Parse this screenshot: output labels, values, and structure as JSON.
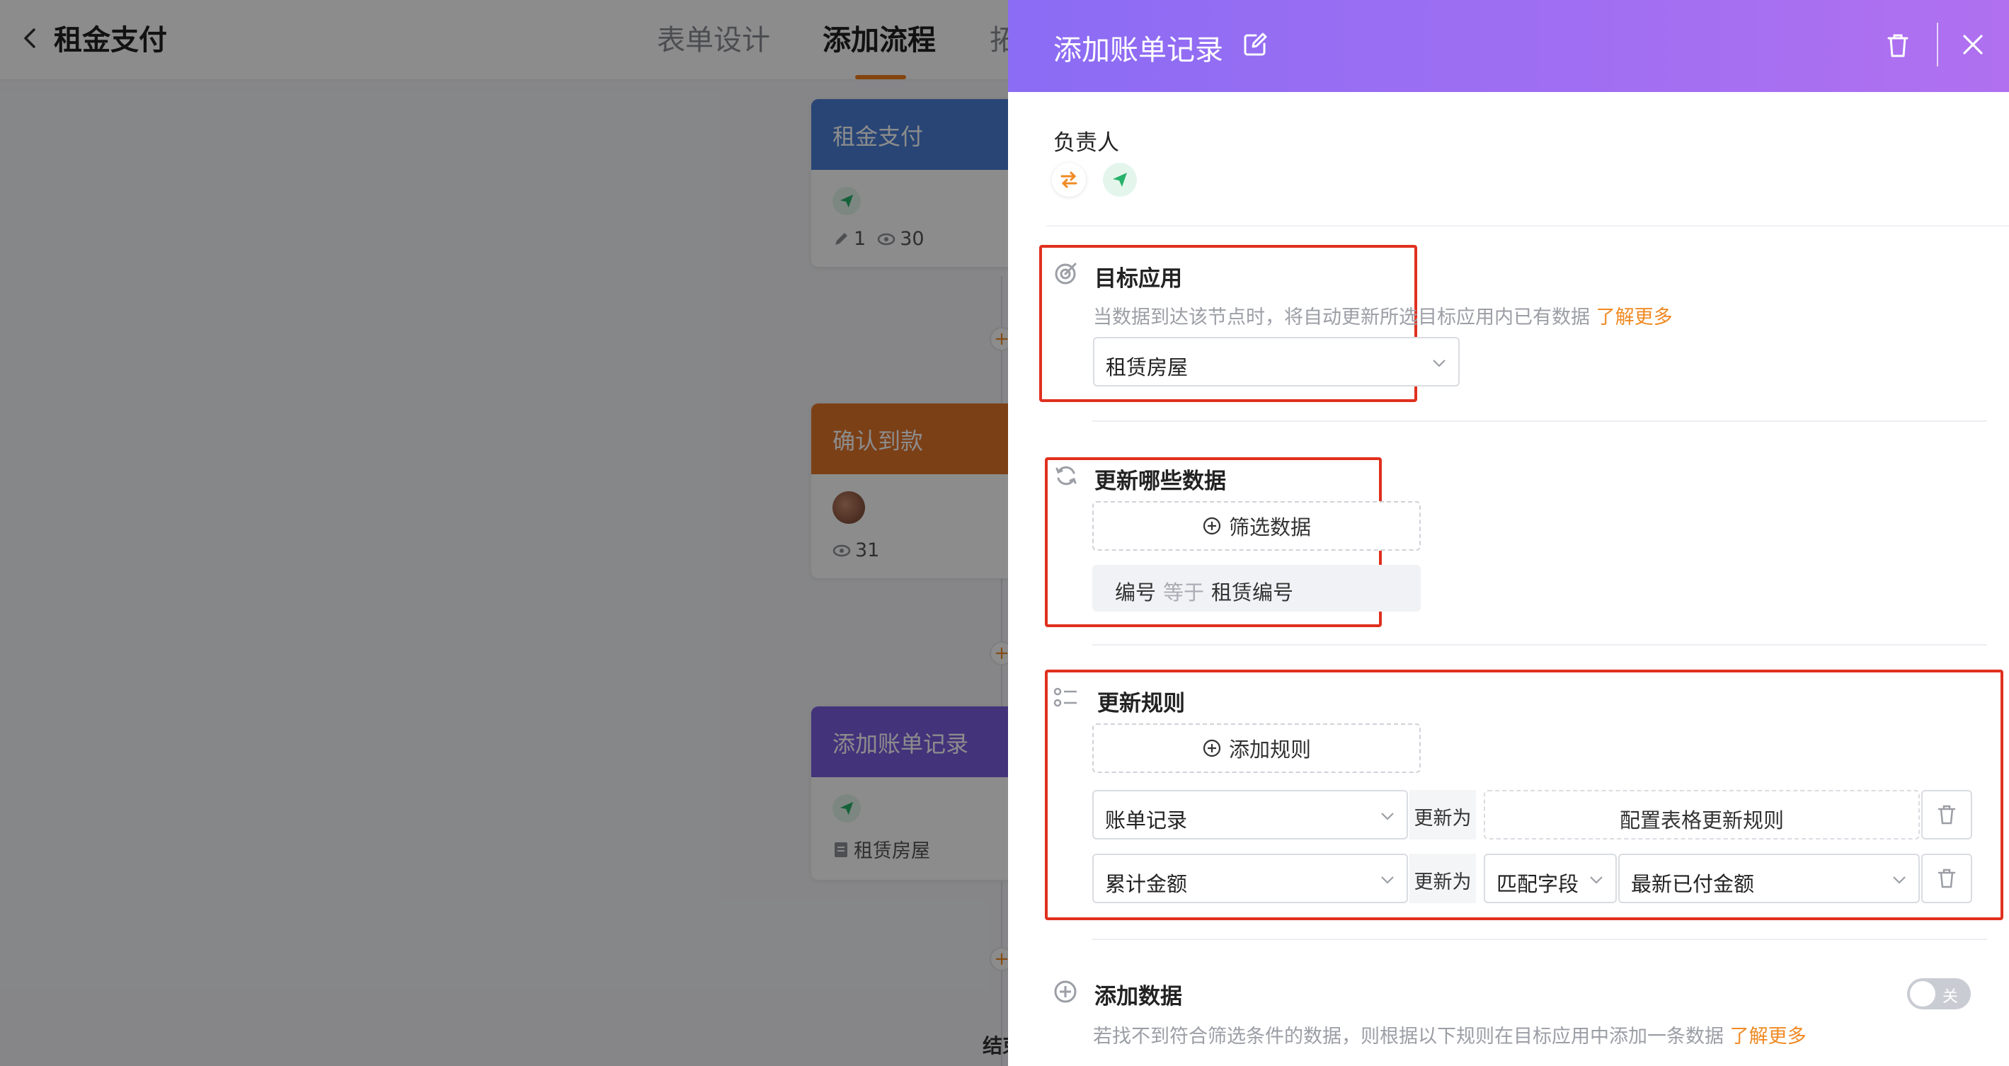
{
  "header": {
    "title": "租金支付",
    "tabs": [
      "表单设计",
      "添加流程",
      "拓"
    ]
  },
  "flow": {
    "nodes": [
      {
        "title": "租金支付",
        "color": "#4a7fd6",
        "stats": {
          "edits": "1",
          "views": "30"
        }
      },
      {
        "title": "确认到款",
        "color": "#e2752a",
        "stats": {
          "views": "31"
        }
      },
      {
        "title": "添加账单记录",
        "color": "#7b5ee0",
        "form": "租赁房屋"
      }
    ],
    "end_label": "结束"
  },
  "drawer": {
    "title": "添加账单记录",
    "owner": {
      "label": "负责人"
    },
    "target_app": {
      "title": "目标应用",
      "desc": "当数据到达该节点时，将自动更新所选目标应用内已有数据",
      "learn_more": "了解更多",
      "selected": "租赁房屋"
    },
    "which_data": {
      "title": "更新哪些数据",
      "filter_btn": "筛选数据",
      "condition": {
        "field": "编号",
        "op": "等于",
        "value": "租赁编号"
      }
    },
    "rules": {
      "title": "更新规则",
      "add_btn": "添加规则",
      "rows": [
        {
          "field": "账单记录",
          "verb": "更新为",
          "config": "配置表格更新规则"
        },
        {
          "field": "累计金额",
          "verb": "更新为",
          "mode": "匹配字段",
          "source": "最新已付金额"
        }
      ]
    },
    "add_data": {
      "title": "添加数据",
      "desc": "若找不到符合筛选条件的数据，则根据以下规则在目标应用中添加一条数据",
      "learn_more": "了解更多",
      "toggle_label": "关"
    }
  },
  "colors": {
    "accent": "#f08a24",
    "header_start": "#8b6cf4",
    "header_end": "#b070f0",
    "highlight": "#e0301e"
  }
}
